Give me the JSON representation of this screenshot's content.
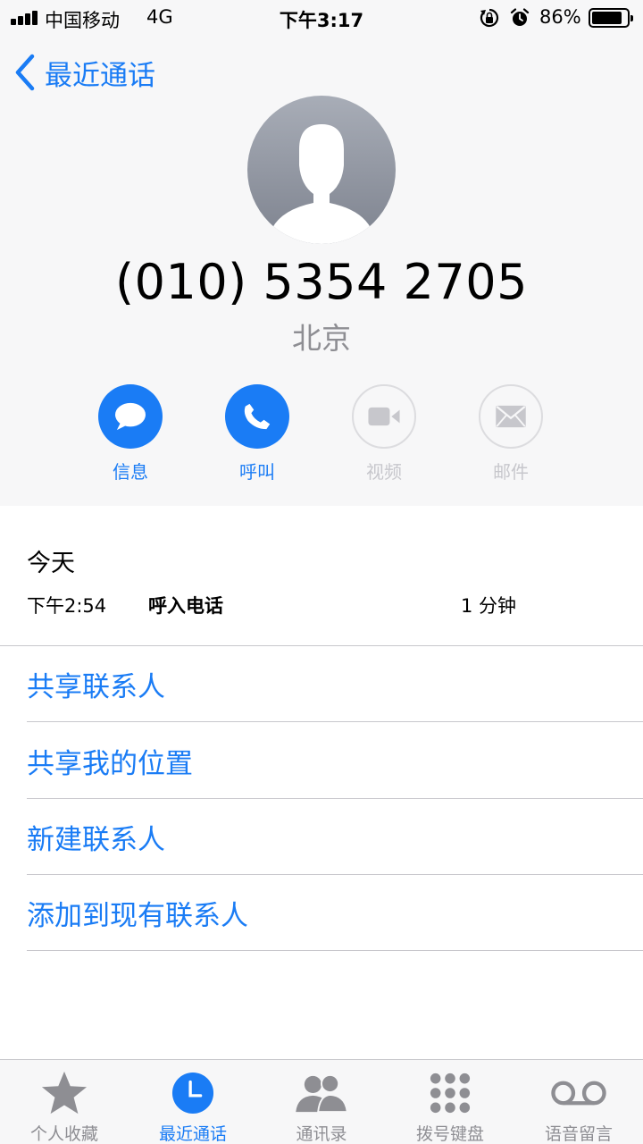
{
  "status_bar": {
    "carrier": "中国移动",
    "network": "4G",
    "time": "下午3:17",
    "battery_percent": "86%",
    "battery_level": 0.86,
    "icons": [
      "signal-icon",
      "rotation-lock-icon",
      "alarm-icon",
      "battery-icon"
    ]
  },
  "nav": {
    "back_label": "最近通话"
  },
  "contact": {
    "phone_number": "(010) 5354 2705",
    "location": "北京"
  },
  "actions": [
    {
      "label": "信息",
      "icon": "message-icon",
      "enabled": true
    },
    {
      "label": "呼叫",
      "icon": "phone-icon",
      "enabled": true
    },
    {
      "label": "视频",
      "icon": "video-icon",
      "enabled": false
    },
    {
      "label": "邮件",
      "icon": "mail-icon",
      "enabled": false
    }
  ],
  "history": {
    "date_label": "今天",
    "entries": [
      {
        "time": "下午2:54",
        "type": "呼入电话",
        "duration": "1 分钟"
      }
    ]
  },
  "options": [
    {
      "label": "共享联系人"
    },
    {
      "label": "共享我的位置"
    },
    {
      "label": "新建联系人"
    },
    {
      "label": "添加到现有联系人"
    }
  ],
  "tab_bar": {
    "tabs": [
      {
        "label": "个人收藏",
        "icon": "star-icon",
        "selected": false
      },
      {
        "label": "最近通话",
        "icon": "clock-icon",
        "selected": true
      },
      {
        "label": "通讯录",
        "icon": "contacts-icon",
        "selected": false
      },
      {
        "label": "拨号键盘",
        "icon": "keypad-icon",
        "selected": false
      },
      {
        "label": "语音留言",
        "icon": "voicemail-icon",
        "selected": false
      }
    ]
  },
  "colors": {
    "accent": "#1a7cf5",
    "inactive": "#c7c7cc",
    "secondary_text": "#8e8e93",
    "header_background": "#f7f7f8"
  }
}
